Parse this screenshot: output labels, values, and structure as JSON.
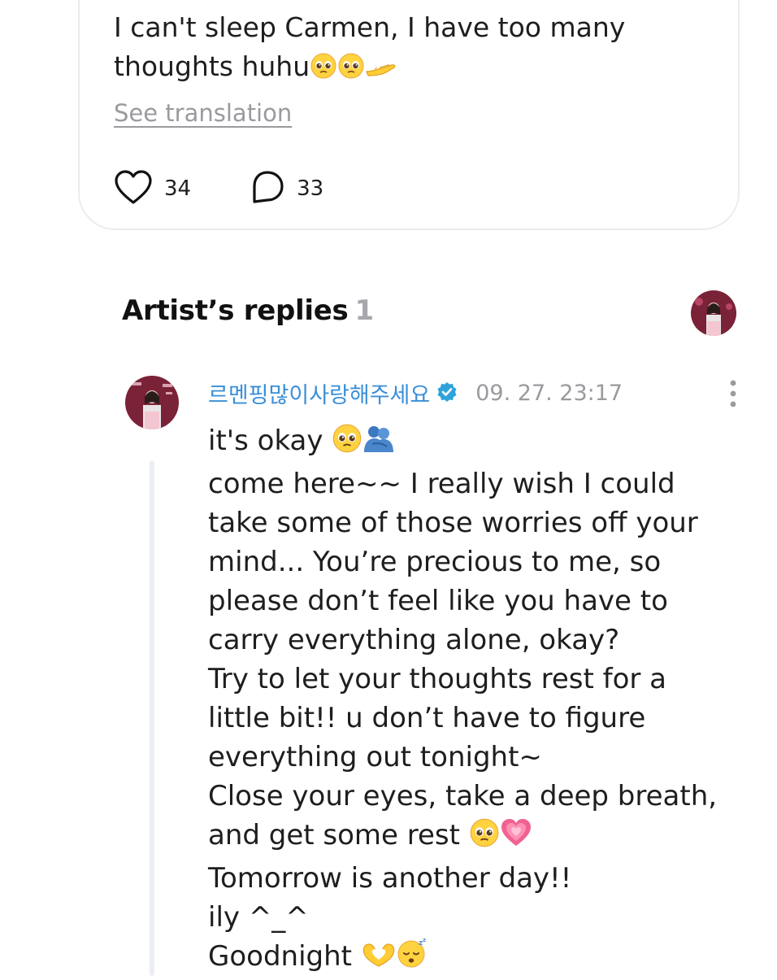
{
  "post": {
    "text_line1": "I can't sleep Carmen, I have too many",
    "text_line2": "thoughts huhu",
    "text_emojis": [
      "pleading-face",
      "pleading-face",
      "offering-hand"
    ],
    "see_translation": "See translation",
    "likes": "34",
    "comments": "33"
  },
  "artist_replies": {
    "title": "Artist’s replies",
    "count": "1"
  },
  "reply": {
    "author": "르멘핑많이사랑해주세요",
    "timestamp": "09. 27. 23:17",
    "lines": [
      "it's okay",
      "come here~~ I really wish I could",
      "take some of those worries off your",
      "mind... You’re precious to me, so",
      "please don’t feel like you have to",
      "carry everything alone, okay?",
      "Try to let your thoughts rest for a",
      "little bit!! u don’t have to figure",
      "everything out tonight~",
      "Close your eyes, take a deep breath,",
      "and get some rest",
      "Tomorrow is another day!!",
      "ily ^_^",
      "Goodnight"
    ],
    "line_emojis": {
      "0": [
        "pleading-face",
        "people-hugging"
      ],
      "10": [
        "pleading-face",
        "growing-heart"
      ],
      "13": [
        "heart-hands",
        "sleeping-face"
      ]
    }
  },
  "colors": {
    "author_blue": "#3a8fd8",
    "muted_gray": "#9a9a9f",
    "card_border": "#ececef",
    "thread_line": "#eceef5"
  }
}
